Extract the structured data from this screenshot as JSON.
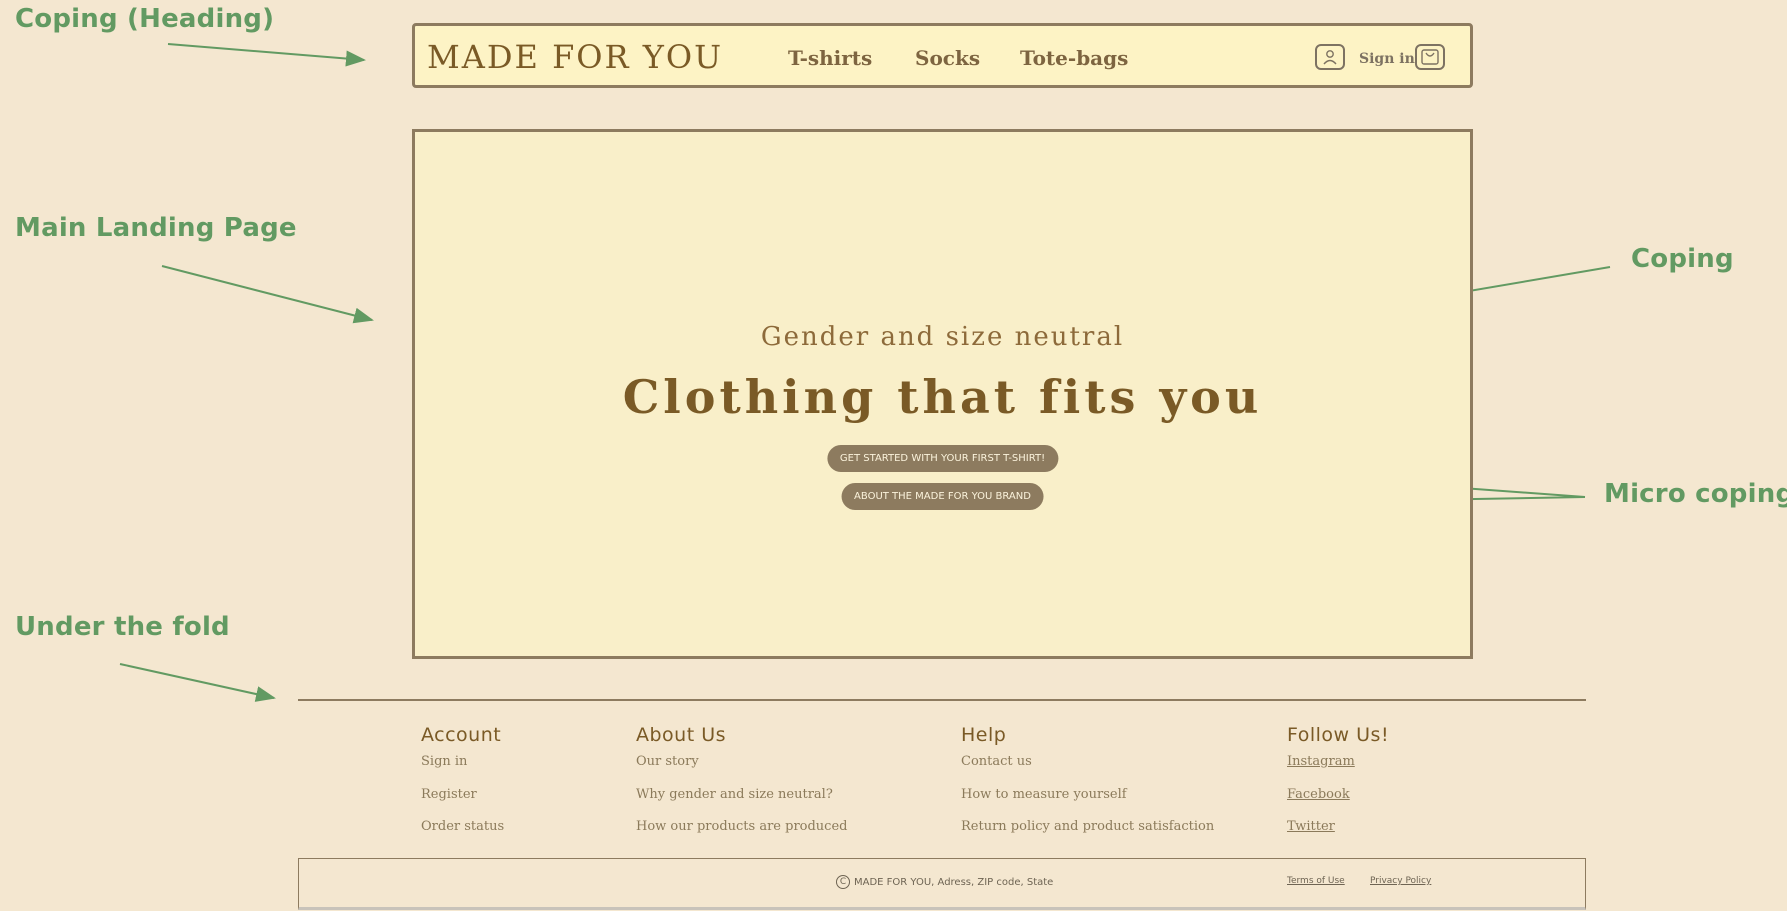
{
  "annotations": {
    "heading": "Coping (Heading)",
    "main": "Main Landing Page",
    "coping": "Coping",
    "micro": "Micro coping",
    "fold": "Under the fold"
  },
  "header": {
    "brand": "MADE FOR YOU",
    "nav": [
      "T-shirts",
      "Socks",
      "Tote-bags"
    ],
    "sign_in": "Sign in",
    "icons": {
      "user": "user-icon",
      "cart": "shopping-bag-icon"
    }
  },
  "hero": {
    "subtitle": "Gender and size neutral",
    "title_start": "Clothing that fits ",
    "title_emph": "you",
    "cta_primary": "GET STARTED WITH YOUR FIRST T-SHIRT!",
    "cta_secondary": "ABOUT THE MADE FOR YOU BRAND"
  },
  "footer": {
    "columns": [
      {
        "title": "Account",
        "links": [
          "Sign in",
          "Register",
          "Order status"
        ]
      },
      {
        "title": "About Us",
        "links": [
          "Our story",
          "Why gender and size neutral?",
          "How our products are produced"
        ]
      },
      {
        "title": "Help",
        "links": [
          "Contact us",
          "How to measure yourself",
          "Return policy and product satisfaction"
        ]
      },
      {
        "title": "Follow Us!",
        "links": [
          "Instagram",
          "Facebook",
          "Twitter"
        ]
      }
    ],
    "copyright_symbol": "C",
    "copyright": "MADE FOR YOU, Adress, ZIP code, State",
    "terms": "Terms of Use",
    "privacy": "Privacy Policy"
  },
  "colors": {
    "background": "#f4e7d0",
    "accent_green": "#629a62",
    "brown": "#7a5a26",
    "button": "#8d7b5f",
    "panel": "#f9efc9"
  }
}
